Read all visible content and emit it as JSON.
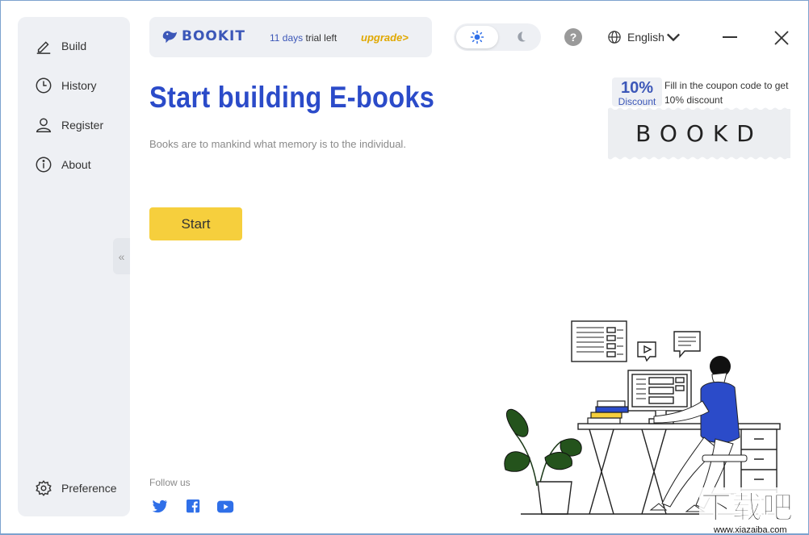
{
  "sidebar": {
    "items": [
      {
        "label": "Build",
        "icon": "pencil-icon"
      },
      {
        "label": "History",
        "icon": "clock-icon"
      },
      {
        "label": "Register",
        "icon": "user-icon"
      },
      {
        "label": "About",
        "icon": "info-icon"
      }
    ],
    "preference": {
      "label": "Preference",
      "icon": "gear-icon"
    },
    "collapse_glyph": "«"
  },
  "header": {
    "logo_text": "BOOKIT",
    "trial_days": "11 days",
    "trial_suffix": "trial left",
    "upgrade_label": "upgrade>",
    "help_label": "?",
    "language": "English"
  },
  "main": {
    "title": "Start building E-books",
    "subtitle": "Books are to mankind what memory is to the individual.",
    "start_label": "Start",
    "follow_label": "Follow us"
  },
  "coupon": {
    "percent": "10%",
    "discount_label": "Discount",
    "text": "Fill in the coupon code to get 10% discount",
    "code": "BOOKD"
  },
  "colors": {
    "accent_blue": "#2b4bc9",
    "start_yellow": "#f6cf3d",
    "upgrade_gold": "#e0a800",
    "panel_gray": "#eef0f4"
  },
  "social": [
    "twitter-icon",
    "facebook-icon",
    "youtube-icon"
  ],
  "watermark": {
    "text": "下载吧",
    "url_text": "www.xiazaiba.com"
  }
}
